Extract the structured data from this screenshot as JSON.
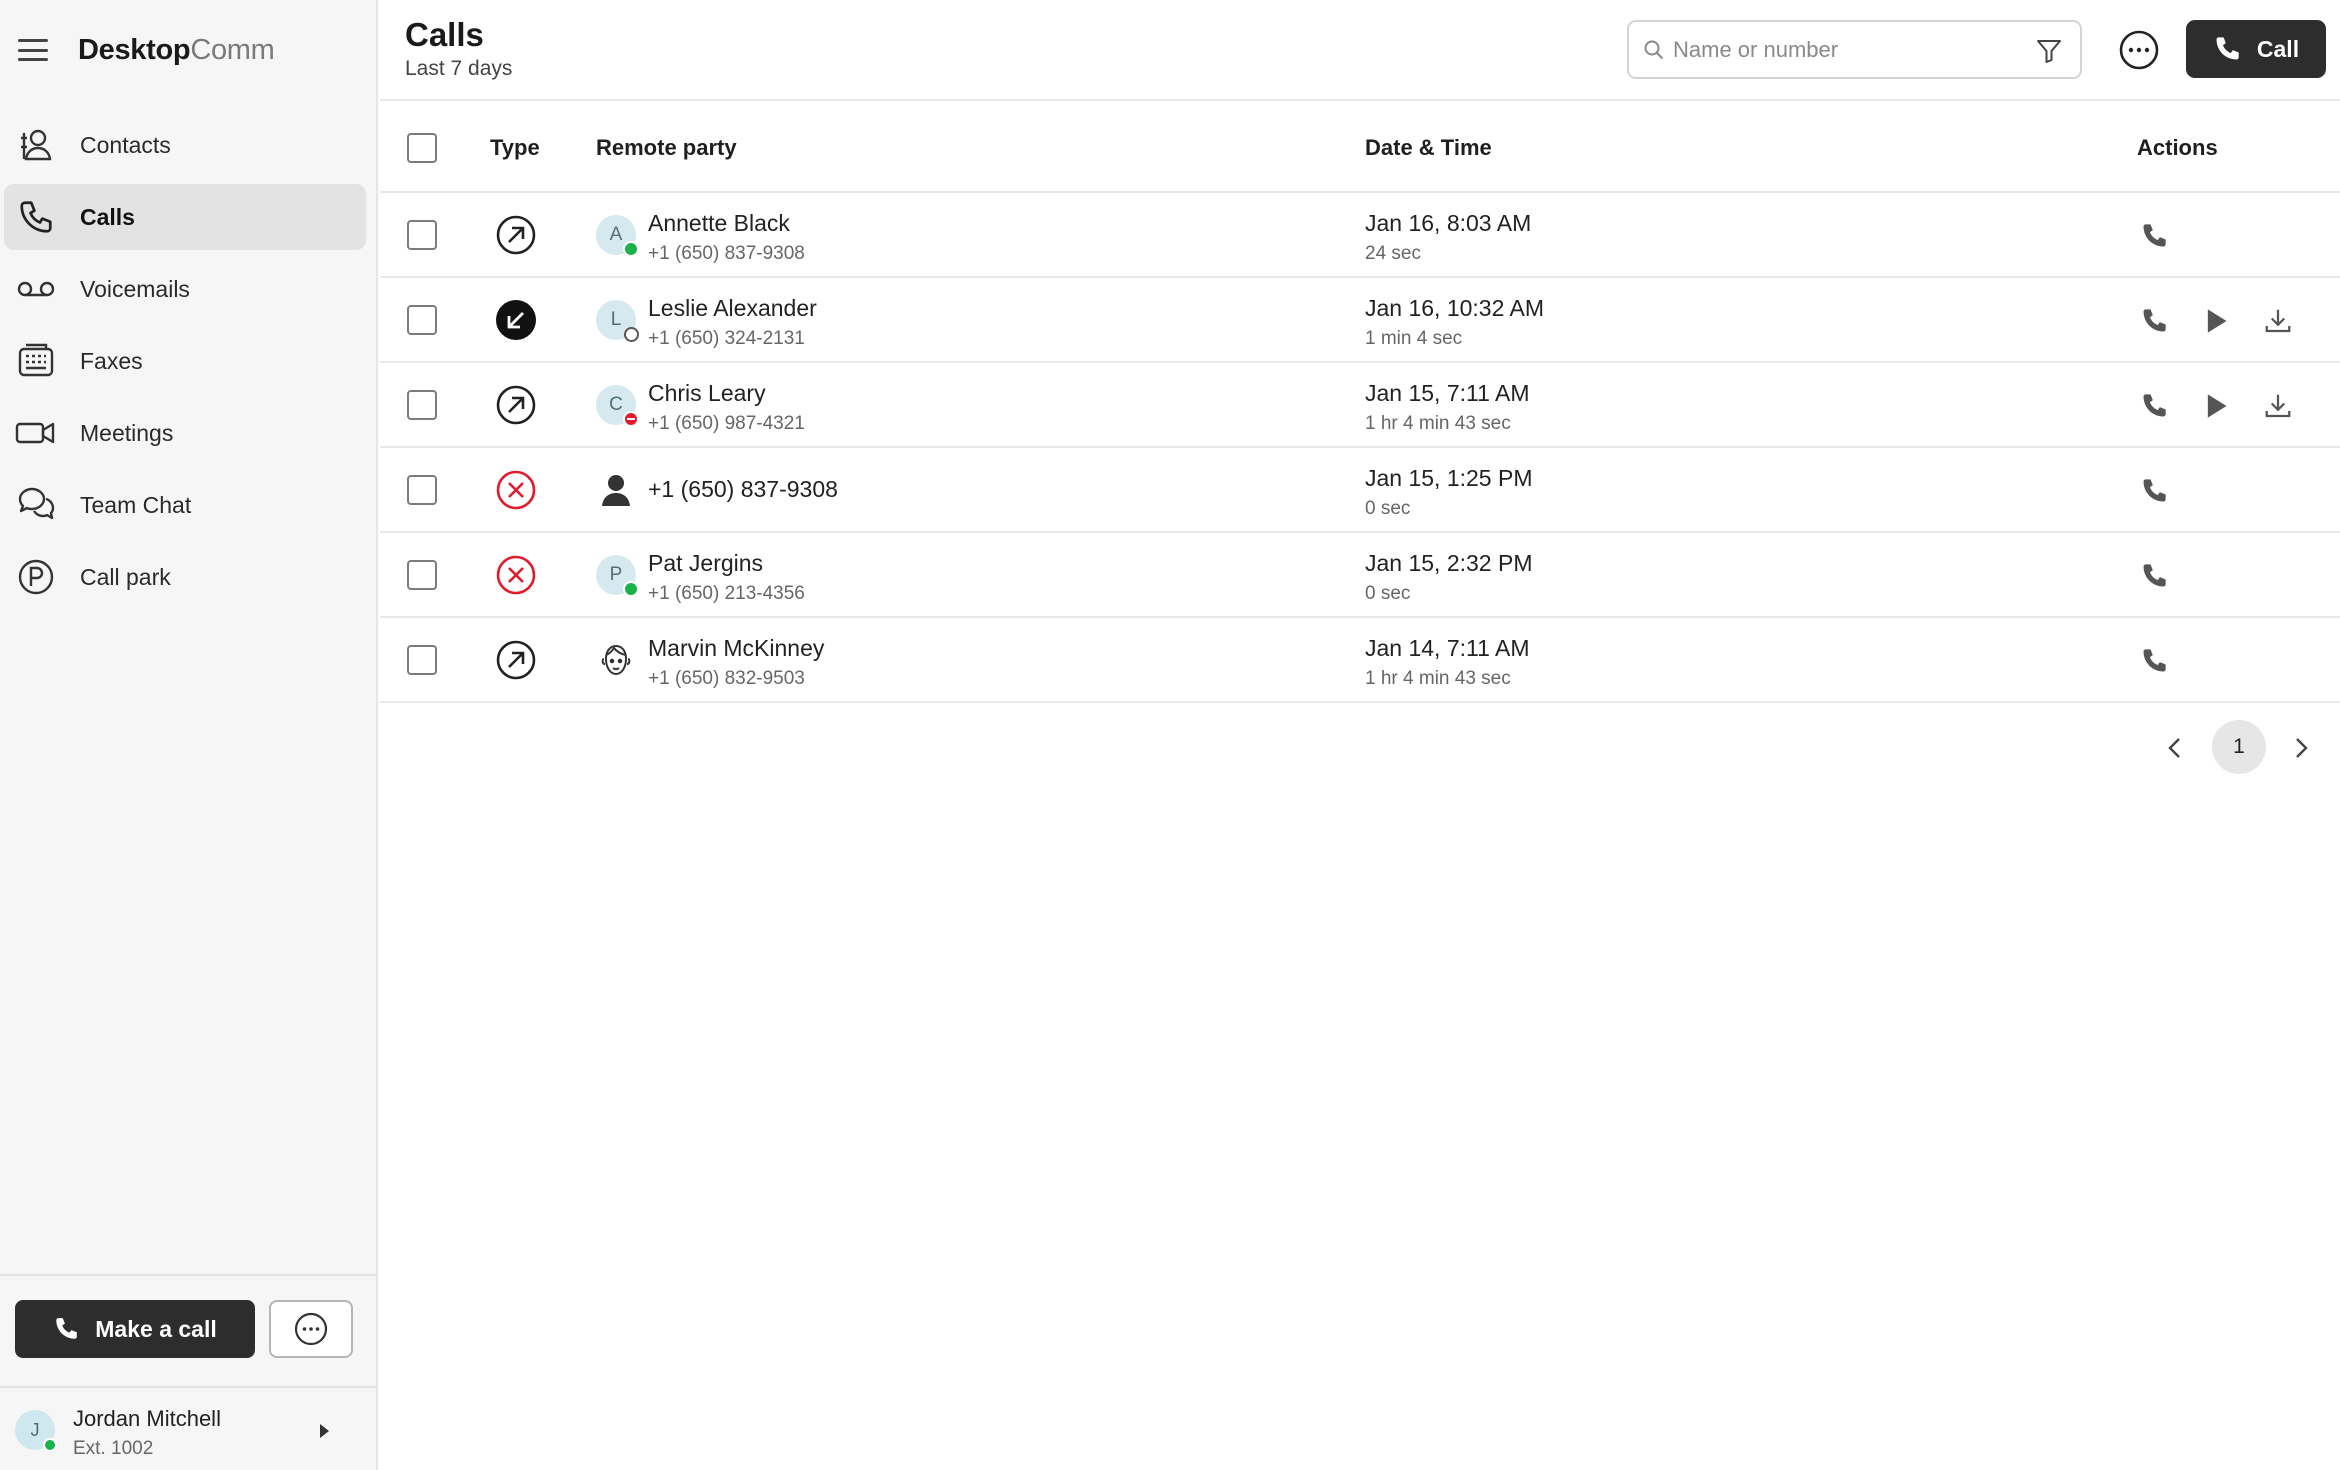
{
  "app": {
    "brand_primary": "Desktop",
    "brand_secondary": "Comm"
  },
  "sidebar": {
    "items": [
      {
        "label": "Contacts",
        "icon": "contacts-icon"
      },
      {
        "label": "Calls",
        "icon": "phone-icon",
        "active": true
      },
      {
        "label": "Voicemails",
        "icon": "voicemail-icon"
      },
      {
        "label": "Faxes",
        "icon": "fax-icon"
      },
      {
        "label": "Meetings",
        "icon": "video-camera-icon"
      },
      {
        "label": "Team Chat",
        "icon": "chat-bubbles-icon"
      },
      {
        "label": "Call park",
        "icon": "parking-icon"
      }
    ],
    "make_call_label": "Make a call",
    "user": {
      "initial": "J",
      "name": "Jordan Mitchell",
      "ext": "Ext. 1002",
      "status": "online"
    }
  },
  "header": {
    "title": "Calls",
    "subtitle": "Last 7 days",
    "search_placeholder": "Name or number",
    "call_label": "Call"
  },
  "table": {
    "columns": {
      "type": "Type",
      "party": "Remote party",
      "datetime": "Date & Time",
      "actions": "Actions"
    },
    "rows": [
      {
        "type": "outgoing",
        "avatar": "A",
        "status": "online",
        "name": "Annette Black",
        "number": "+1 (650) 837-9308",
        "datetime": "Jan 16, 8:03 AM",
        "duration": "24 sec",
        "actions": [
          "call"
        ]
      },
      {
        "type": "incoming",
        "avatar": "L",
        "status": "offline",
        "name": "Leslie Alexander",
        "number": "+1 (650) 324-2131",
        "datetime": "Jan 16, 10:32 AM",
        "duration": "1 min 4 sec",
        "actions": [
          "call",
          "play",
          "download"
        ]
      },
      {
        "type": "outgoing",
        "avatar": "C",
        "status": "dnd",
        "name": "Chris Leary",
        "number": "+1 (650) 987-4321",
        "datetime": "Jan 15, 7:11 AM",
        "duration": "1 hr 4 min 43 sec",
        "actions": [
          "call",
          "play",
          "download"
        ]
      },
      {
        "type": "missed",
        "avatar": "person-silhouette-icon",
        "status": "",
        "name": "",
        "number": "+1 (650) 837-9308",
        "datetime": "Jan 15, 1:25 PM",
        "duration": "0 sec",
        "actions": [
          "call"
        ]
      },
      {
        "type": "missed",
        "avatar": "P",
        "status": "online",
        "name": "Pat Jergins",
        "number": "+1 (650) 213-4356",
        "datetime": "Jan 15, 2:32 PM",
        "duration": "0 sec",
        "actions": [
          "call"
        ]
      },
      {
        "type": "outgoing",
        "avatar": "face-illustration-icon",
        "status": "",
        "name": "Marvin McKinney",
        "number": "+1 (650) 832-9503",
        "datetime": "Jan 14, 7:11 AM",
        "duration": "1 hr 4 min 43 sec",
        "actions": [
          "call"
        ]
      }
    ]
  },
  "pagination": {
    "current": "1"
  },
  "colors": {
    "accent_dark": "#2d2d2d",
    "online": "#1bb24a",
    "missed": "#e21b2c",
    "sidebar_bg": "#f6f6f6"
  }
}
